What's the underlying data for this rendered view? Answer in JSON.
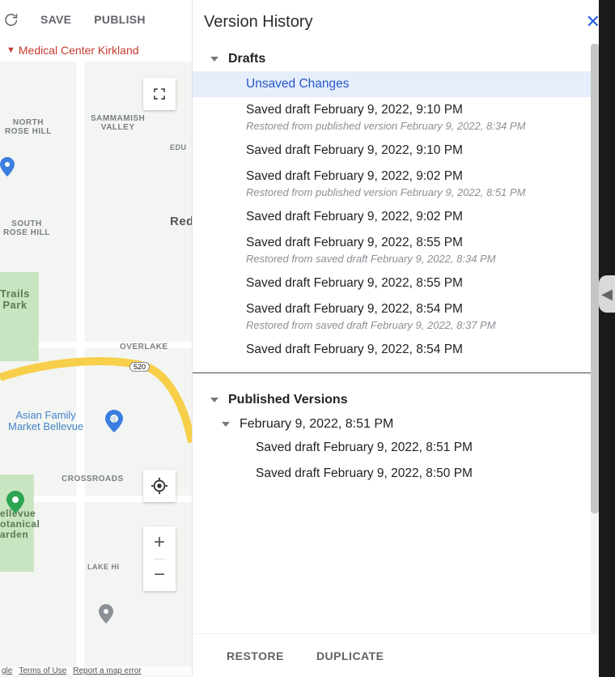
{
  "toolbar": {
    "save": "SAVE",
    "publish": "PUBLISH"
  },
  "place_header": "Medical Center Kirkland",
  "map": {
    "labels": {
      "north_rose_hill": "NORTH\nROSE HILL",
      "sammamish": "SAMMAMISH\nVALLEY",
      "edu": "EDU",
      "redm": "Redm",
      "south_rose_hill": "SOUTH\nROSE HILL",
      "trails_park": "Trails\nPark",
      "overlake": "OVERLAKE",
      "asian_family": "Asian Family\nMarket Bellevue",
      "crossroads": "CROSSROADS",
      "bellevue_garden": "ellevue\notanical\narden",
      "lake_hi": "LAKE HI",
      "hwy": "520"
    },
    "footer_items": [
      "gle",
      "Terms of Use",
      "Report a map error"
    ]
  },
  "panel": {
    "title": "Version History",
    "sections": {
      "drafts_label": "Drafts",
      "published_label": "Published Versions"
    },
    "drafts": [
      {
        "label": "Unsaved Changes",
        "selected": true
      },
      {
        "label": "Saved draft February 9, 2022, 9:10 PM",
        "note": "Restored from published version February 9, 2022, 8:34 PM"
      },
      {
        "label": "Saved draft February 9, 2022, 9:10 PM"
      },
      {
        "label": "Saved draft February 9, 2022, 9:02 PM",
        "note": "Restored from published version February 9, 2022, 8:51 PM"
      },
      {
        "label": "Saved draft February 9, 2022, 9:02 PM"
      },
      {
        "label": "Saved draft February 9, 2022, 8:55 PM",
        "note": "Restored from saved draft February 9, 2022, 8:34 PM"
      },
      {
        "label": "Saved draft February 9, 2022, 8:55 PM"
      },
      {
        "label": "Saved draft February 9, 2022, 8:54 PM",
        "note": "Restored from saved draft February 9, 2022, 8:37 PM"
      },
      {
        "label": "Saved draft February 9, 2022, 8:54 PM"
      }
    ],
    "published_group_label": "February 9, 2022, 8:51 PM",
    "published_children": [
      {
        "label": "Saved draft February 9, 2022, 8:51 PM"
      },
      {
        "label": "Saved draft February 9, 2022, 8:50 PM"
      }
    ],
    "footer": {
      "restore": "RESTORE",
      "duplicate": "DUPLICATE"
    }
  }
}
